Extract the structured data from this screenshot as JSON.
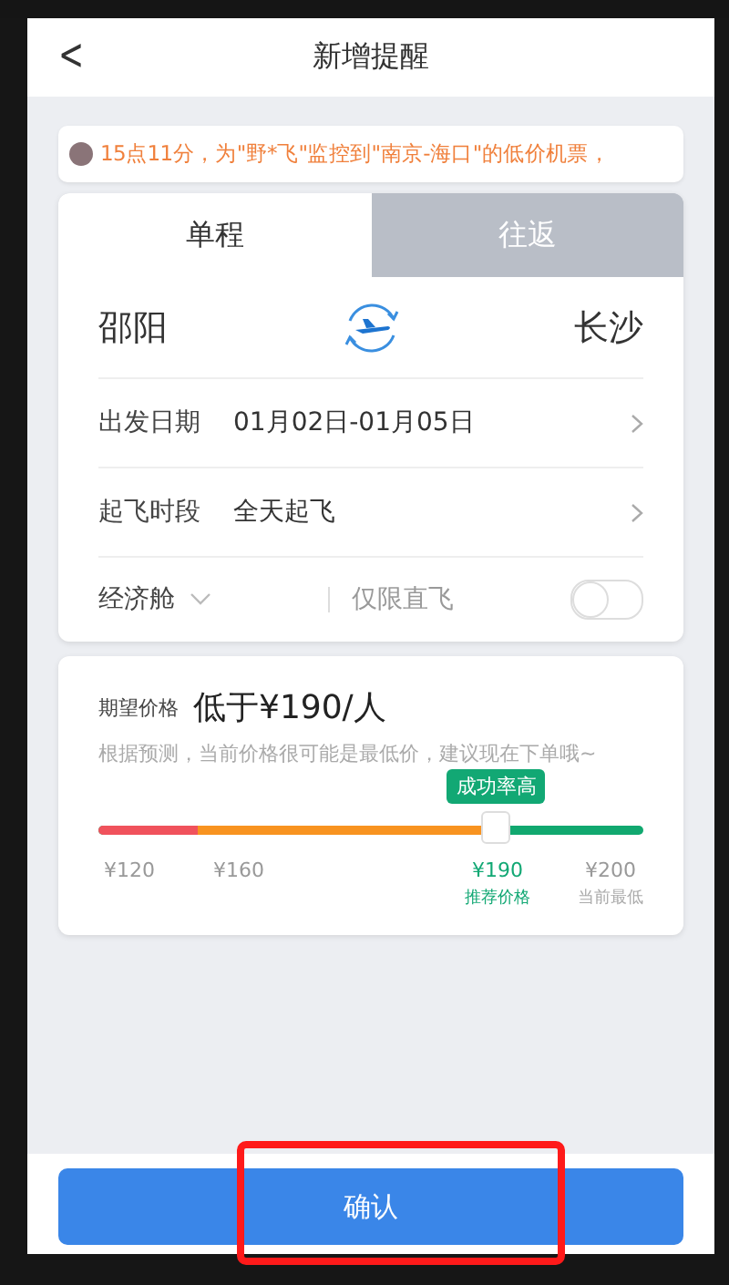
{
  "header": {
    "back_icon": "<",
    "title": "新增提醒"
  },
  "notice": {
    "text": "15点11分，为\"野*飞\"监控到\"南京-海口\"的低价机票，"
  },
  "tabs": [
    {
      "label": "单程",
      "selected": true
    },
    {
      "label": "往返",
      "selected": false
    }
  ],
  "route": {
    "from": "邵阳",
    "to": "长沙"
  },
  "rows": [
    {
      "label": "出发日期",
      "value": "01月02日-01月05日"
    },
    {
      "label": "起飞时段",
      "value": "全天起飞"
    }
  ],
  "cabin": {
    "label": "经济舱",
    "direct_label": "仅限直飞",
    "direct_on": false
  },
  "price": {
    "label": "期望价格",
    "value": "低于¥190/人",
    "hint": "根据预测，当前价格很可能是最低价，建议现在下单哦~",
    "badge": "成功率高",
    "level": 0.73,
    "ticks": [
      {
        "value": "¥120",
        "kind": "plain"
      },
      {
        "value": "¥160",
        "kind": "plain"
      },
      {
        "value": "¥190",
        "caption": "推荐价格",
        "kind": "recommended"
      },
      {
        "value": "¥200",
        "caption": "当前最低",
        "kind": "current"
      }
    ]
  },
  "confirm_button": "确认"
}
